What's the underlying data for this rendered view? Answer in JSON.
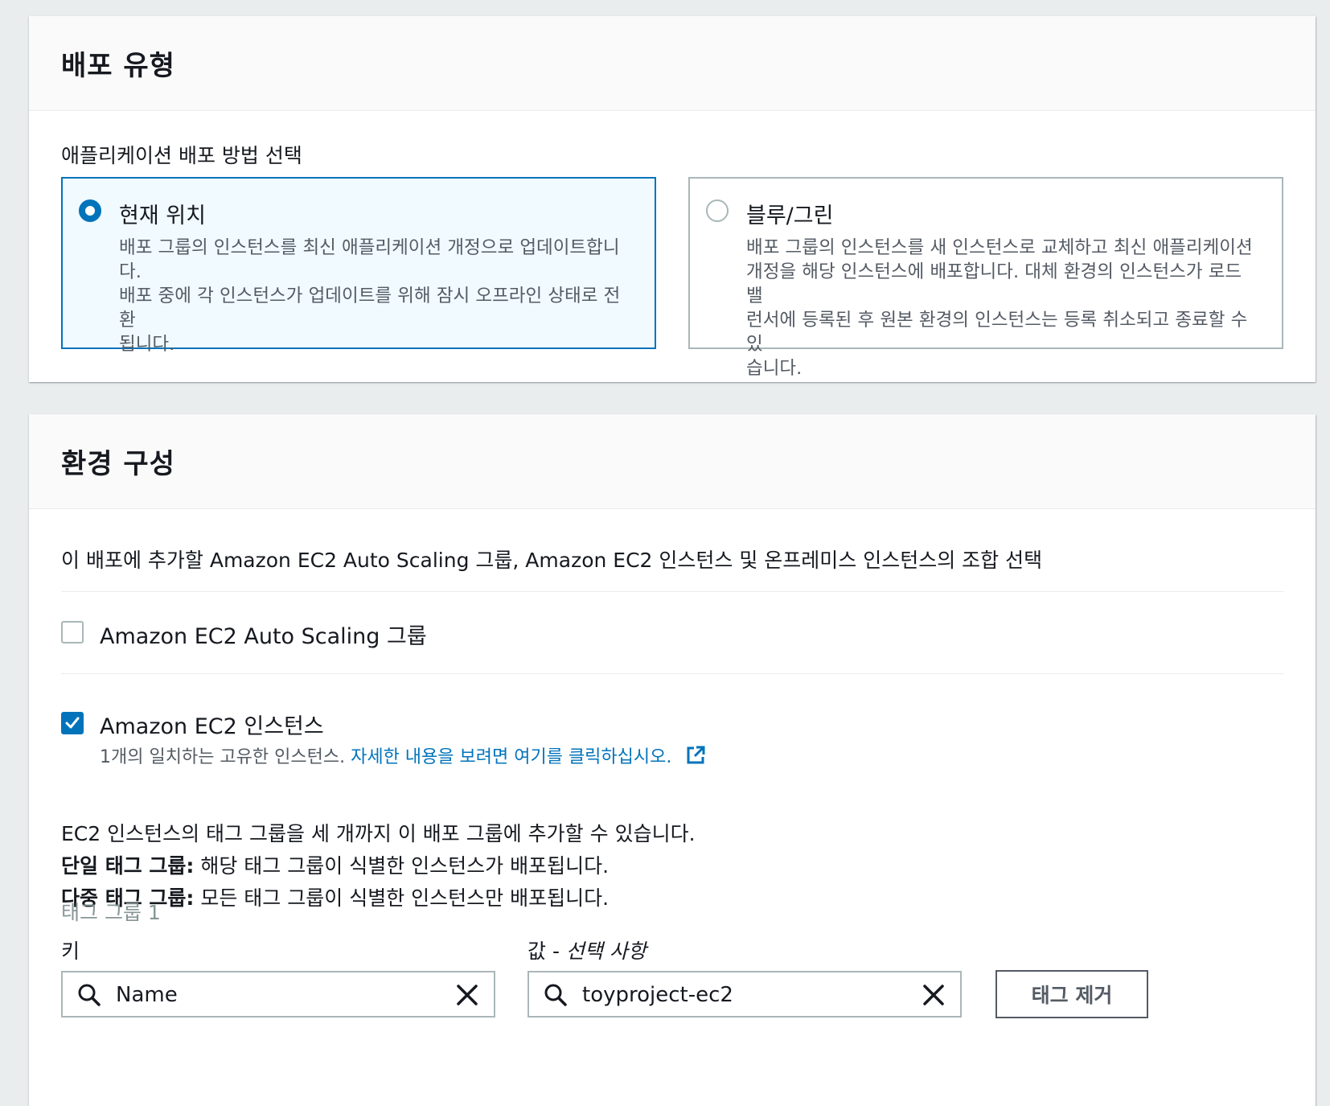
{
  "deployment_type": {
    "title": "배포 유형",
    "subtitle": "애플리케이션 배포 방법 선택",
    "options": [
      {
        "title": "현재 위치",
        "lines": [
          "배포 그룹의 인스턴스를 최신 애플리케이션 개정으로 업데이트합니다.",
          "배포 중에 각 인스턴스가 업데이트를 위해 잠시 오프라인 상태로 전환",
          "됩니다."
        ],
        "selected": true
      },
      {
        "title": "블루/그린",
        "lines": [
          "배포 그룹의 인스턴스를 새 인스턴스로 교체하고 최신 애플리케이션",
          "개정을 해당 인스턴스에 배포합니다. 대체 환경의 인스턴스가 로드 밸",
          "런서에 등록된 후 원본 환경의 인스턴스는 등록 취소되고 종료할 수 있",
          "습니다."
        ],
        "selected": false
      }
    ]
  },
  "environment": {
    "title": "환경 구성",
    "description": "이 배포에 추가할 Amazon EC2 Auto Scaling 그룹, Amazon EC2 인스턴스 및 온프레미스 인스턴스의 조합 선택",
    "asg_option": {
      "label": "Amazon EC2 Auto Scaling 그룹",
      "checked": false
    },
    "ec2_option": {
      "label": "Amazon EC2 인스턴스",
      "checked": true,
      "match_text": "1개의 일치하는 고유한 인스턴스.",
      "link_text": "자세한 내용을 보려면 여기를 클릭하십시오."
    },
    "info": {
      "line1": "EC2 인스턴스의 태그 그룹을 세 개까지 이 배포 그룹에 추가할 수 있습니다.",
      "single_bold": "단일 태그 그룹:",
      "single_text": " 해당 태그 그룹이 식별한 인스턴스가 배포됩니다.",
      "multi_bold": "다중 태그 그룹:",
      "multi_text": " 모든 태그 그룹이 식별한 인스턴스만 배포됩니다."
    },
    "tag_group": {
      "title": "태그 그룹 1",
      "key_label": "키",
      "value_label_main": "값 - ",
      "value_label_optional": "선택 사항",
      "key_value": "Name",
      "value_value": "toyproject-ec2",
      "remove_button": "태그 제거"
    }
  },
  "icons": {
    "radio_selected": "radio-selected-icon",
    "checkbox_checked": "check-icon",
    "external_link": "external-link-icon",
    "search": "search-icon",
    "clear": "close-icon"
  },
  "colors": {
    "accent": "#0073bb",
    "border": "#aab7b8",
    "muted": "#545b64"
  }
}
